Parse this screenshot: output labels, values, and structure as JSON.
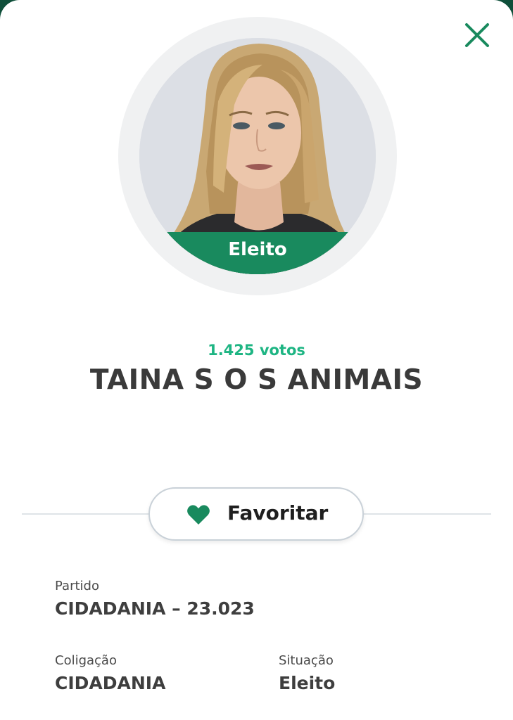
{
  "modal": {
    "close_icon": "close-icon",
    "status_badge": "Eleito",
    "votes": "1.425 votos",
    "candidate_name": "TAINA S O S ANIMAIS",
    "favorite_button": {
      "label": "Favoritar",
      "icon": "heart-icon"
    },
    "details": {
      "partido_label": "Partido",
      "partido_value": "CIDADANIA – 23.023",
      "coligacao_label": "Coligação",
      "coligacao_value": "CIDADANIA",
      "situacao_label": "Situação",
      "situacao_value": "Eleito"
    }
  },
  "colors": {
    "accent_green": "#198a5e",
    "votes_green": "#1eb583",
    "header_dark_green": "#0f4f3a",
    "text_dark": "#3a3a3a"
  }
}
